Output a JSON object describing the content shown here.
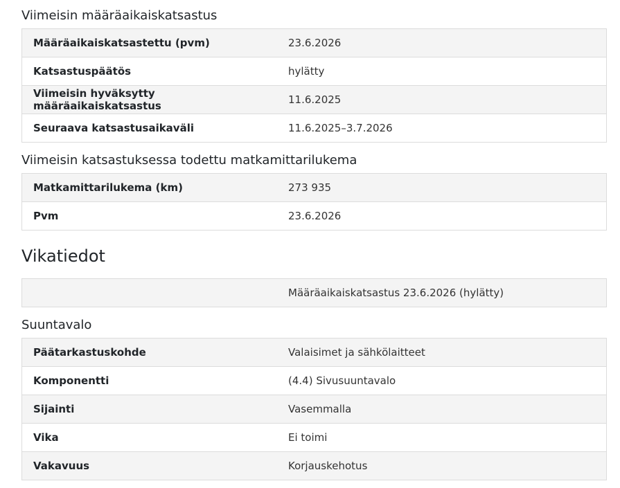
{
  "periodic_inspection": {
    "title": "Viimeisin määräaikaiskatsastus",
    "rows": [
      {
        "label": "Määräaikaiskatsastettu (pvm)",
        "value": "23.6.2026"
      },
      {
        "label": "Katsastuspäätös",
        "value": "hylätty"
      },
      {
        "label": "Viimeisin hyväksytty määräaikaiskatsastus",
        "value": "11.6.2025"
      },
      {
        "label": "Seuraava katsastusaikaväli",
        "value": "11.6.2025–3.7.2026"
      }
    ]
  },
  "odometer": {
    "title": "Viimeisin katsastuksessa todettu matkamittarilukema",
    "rows": [
      {
        "label": "Matkamittarilukema (km)",
        "value": "273 935"
      },
      {
        "label": "Pvm",
        "value": "23.6.2026"
      }
    ]
  },
  "faults": {
    "title": "Vikatiedot",
    "inspection_row": {
      "label": "",
      "value": "Määräaikaiskatsastus 23.6.2026 (hylätty)"
    },
    "group_title": "Suuntavalo",
    "rows": [
      {
        "label": "Päätarkastuskohde",
        "value": "Valaisimet ja sähkölaitteet"
      },
      {
        "label": "Komponentti",
        "value": "(4.4) Sivusuuntavalo"
      },
      {
        "label": "Sijainti",
        "value": "Vasemmalla"
      },
      {
        "label": "Vika",
        "value": "Ei toimi"
      },
      {
        "label": "Vakavuus",
        "value": "Korjauskehotus"
      }
    ]
  }
}
